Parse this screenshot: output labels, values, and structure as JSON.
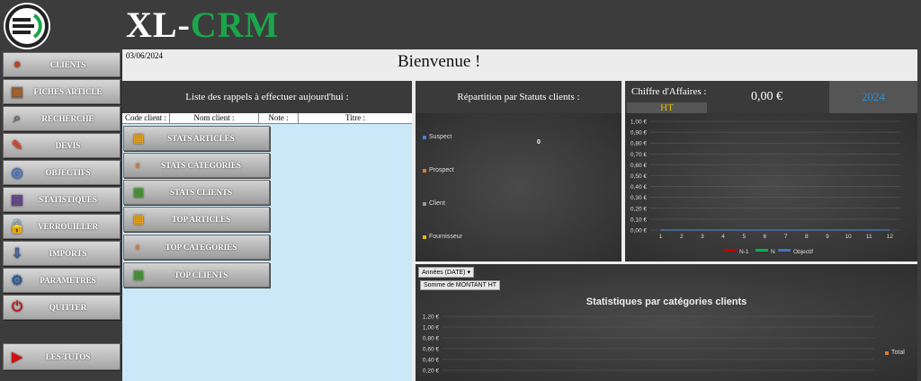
{
  "brand": {
    "prefix": "XL-",
    "suffix": "CRM"
  },
  "date": "03/06/2024",
  "welcome": "Bienvenue !",
  "sidebar": [
    {
      "label": "CLIENTS",
      "icon": "client-icon"
    },
    {
      "label": "FICHES ARTICLE",
      "icon": "box-icon"
    },
    {
      "label": "RECHERCHE",
      "icon": "magnifier-icon"
    },
    {
      "label": "DEVIS",
      "icon": "quote-icon"
    },
    {
      "label": "OBJECTIFS",
      "icon": "target-icon"
    },
    {
      "label": "STATISTIQUES",
      "icon": "stats-icon"
    },
    {
      "label": "VERROUILLER",
      "icon": "lock-icon"
    },
    {
      "label": "IMPORTS",
      "icon": "import-icon"
    },
    {
      "label": "PARAMETRES",
      "icon": "settings-icon"
    },
    {
      "label": "QUITTER",
      "icon": "exit-icon"
    }
  ],
  "tutos": {
    "label": "LES TUTOS",
    "icon": "youtube-icon"
  },
  "rappels": {
    "title": "Liste des rappels à effectuer aujourd'hui :",
    "columns": [
      "Code client :",
      "Nom client :",
      "Note :",
      "Titre :"
    ]
  },
  "stat_buttons": [
    {
      "label": "STATS ARTICLES",
      "icon": "articles-icon"
    },
    {
      "label": "STATS CATEGORIES",
      "icon": "pie-icon"
    },
    {
      "label": "STATS CLIENTS",
      "icon": "bar-chart-icon"
    },
    {
      "label": "TOP ARTICLES",
      "icon": "articles-icon"
    },
    {
      "label": "TOP CATEGORIES",
      "icon": "pie-icon"
    },
    {
      "label": "TOP CLIENTS",
      "icon": "bar-chart-icon"
    }
  ],
  "repartition": {
    "title": "Répartition par Statuts clients :",
    "center_value": "0",
    "legend": [
      {
        "label": "Suspect",
        "color": "#4a7fd4"
      },
      {
        "label": "Prospect",
        "color": "#e07a2a"
      },
      {
        "label": "Client",
        "color": "#9a9a9a"
      },
      {
        "label": "Fournisseur",
        "color": "#e6b800"
      }
    ]
  },
  "ca": {
    "title": "Chiffre d'Affaires :",
    "value": "0,00 €",
    "year": "2024",
    "ht": "HT"
  },
  "cat": {
    "filter": "Années (DATE)",
    "sum_label": "Somme de MONTANT HT",
    "title": "Statistiques par catégories clients",
    "legend": "Total"
  },
  "chart_data": [
    {
      "type": "line",
      "x": [
        1,
        2,
        3,
        4,
        5,
        6,
        7,
        8,
        9,
        10,
        11,
        12
      ],
      "yticks": [
        "1,00 €",
        "0,90 €",
        "0,80 €",
        "0,70 €",
        "0,60 €",
        "0,50 €",
        "0,40 €",
        "0,30 €",
        "0,20 €",
        "0,10 €",
        "0,00 €"
      ],
      "ylim": [
        0,
        1
      ],
      "series": [
        {
          "name": "N-1",
          "color": "#c00000",
          "values": [
            0,
            0,
            0,
            0,
            0,
            0,
            0,
            0,
            0,
            0,
            0,
            0
          ]
        },
        {
          "name": "N",
          "color": "#00b050",
          "values": [
            0,
            0,
            0,
            0,
            0,
            0,
            0,
            0,
            0,
            0,
            0,
            0
          ]
        },
        {
          "name": "Objectif",
          "color": "#4472c4",
          "values": [
            0,
            0,
            0,
            0,
            0,
            0,
            0,
            0,
            0,
            0,
            0,
            0
          ]
        }
      ],
      "grid": true,
      "legend": "bottom"
    },
    {
      "type": "bar",
      "title": "Statistiques par catégories clients",
      "yticks": [
        "1,20 €",
        "1,00 €",
        "0,80 €",
        "0,60 €",
        "0,40 €",
        "0,20 €"
      ],
      "ylim": [
        0,
        1.2
      ],
      "series": [
        {
          "name": "Total",
          "color": "#e07a2a",
          "values": []
        }
      ],
      "grid": true,
      "legend": "right"
    }
  ],
  "colors": {
    "brand_green": "#1aa64a",
    "year_blue": "#2a8fd8",
    "ht_yellow": "#e6b800"
  }
}
